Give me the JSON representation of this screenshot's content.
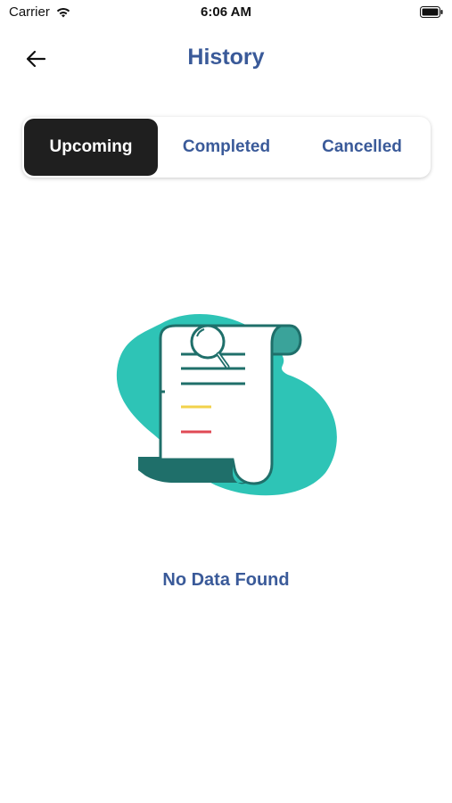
{
  "status_bar": {
    "carrier": "Carrier",
    "time": "6:06 AM"
  },
  "header": {
    "title": "History",
    "back_icon": "arrow-left-icon"
  },
  "tabs": [
    {
      "label": "Upcoming",
      "active": true
    },
    {
      "label": "Completed",
      "active": false
    },
    {
      "label": "Cancelled",
      "active": false
    }
  ],
  "empty_state": {
    "message": "No Data Found",
    "illustration": "document-search-icon"
  },
  "colors": {
    "accent": "#3a5a99",
    "active_tab": "#1f1f1f",
    "teal_blob": "#2ec4b6",
    "document_stroke": "#1f6f6a",
    "yellow_line": "#f2d24b",
    "red_line": "#e04a55"
  }
}
